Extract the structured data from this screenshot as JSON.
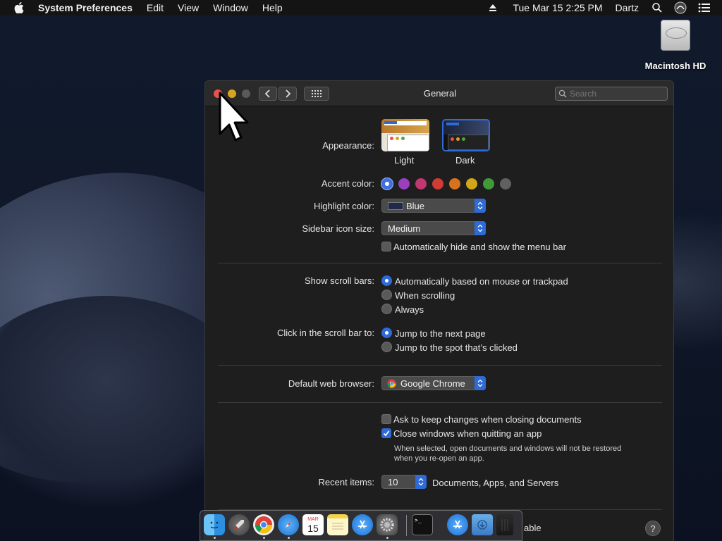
{
  "menubar": {
    "app_name": "System Preferences",
    "items": [
      "Edit",
      "View",
      "Window",
      "Help"
    ],
    "clock": "Tue Mar 15  2:25 PM",
    "user": "Dartz"
  },
  "desktop": {
    "hd_label": "Macintosh HD"
  },
  "window": {
    "title": "General",
    "search_placeholder": "Search"
  },
  "general": {
    "appearance_label": "Appearance:",
    "appearance_options": [
      "Light",
      "Dark"
    ],
    "appearance_selected": "Dark",
    "accent_label": "Accent color:",
    "accent_colors": [
      "#3f6fe0",
      "#9b3fbf",
      "#c1376f",
      "#d03b33",
      "#d8721f",
      "#d3a51a",
      "#3f9a37",
      "#606060"
    ],
    "accent_selected_index": 0,
    "highlight_label": "Highlight color:",
    "highlight_value": "Blue",
    "sidebar_label": "Sidebar icon size:",
    "sidebar_value": "Medium",
    "auto_hide_menu": {
      "label": "Automatically hide and show the menu bar",
      "checked": false
    },
    "scroll_label": "Show scroll bars:",
    "scroll_options": [
      "Automatically based on mouse or trackpad",
      "When scrolling",
      "Always"
    ],
    "scroll_selected": 0,
    "click_label": "Click in the scroll bar to:",
    "click_options": [
      "Jump to the next page",
      "Jump to the spot that’s clicked"
    ],
    "click_selected": 0,
    "browser_label": "Default web browser:",
    "browser_value": "Google Chrome",
    "ask_keep": {
      "label": "Ask to keep changes when closing documents",
      "checked": false
    },
    "close_windows": {
      "label": "Close windows when quitting an app",
      "checked": true
    },
    "close_note_line1": "When selected, open documents and windows will not be restored",
    "close_note_line2": "when you re-open an app.",
    "recent_label": "Recent items:",
    "recent_value": "10",
    "recent_suffix": "Documents, Apps, and Servers",
    "bottom_partial": "able",
    "help": "?"
  },
  "dock": {
    "apps": [
      "Finder",
      "Launchpad",
      "Google Chrome",
      "Safari",
      "Calendar",
      "Notes",
      "App Store",
      "System Preferences",
      "Terminal",
      "App Store",
      "Downloads",
      "Trash"
    ],
    "calendar_month": "MAR",
    "calendar_day": "15"
  }
}
